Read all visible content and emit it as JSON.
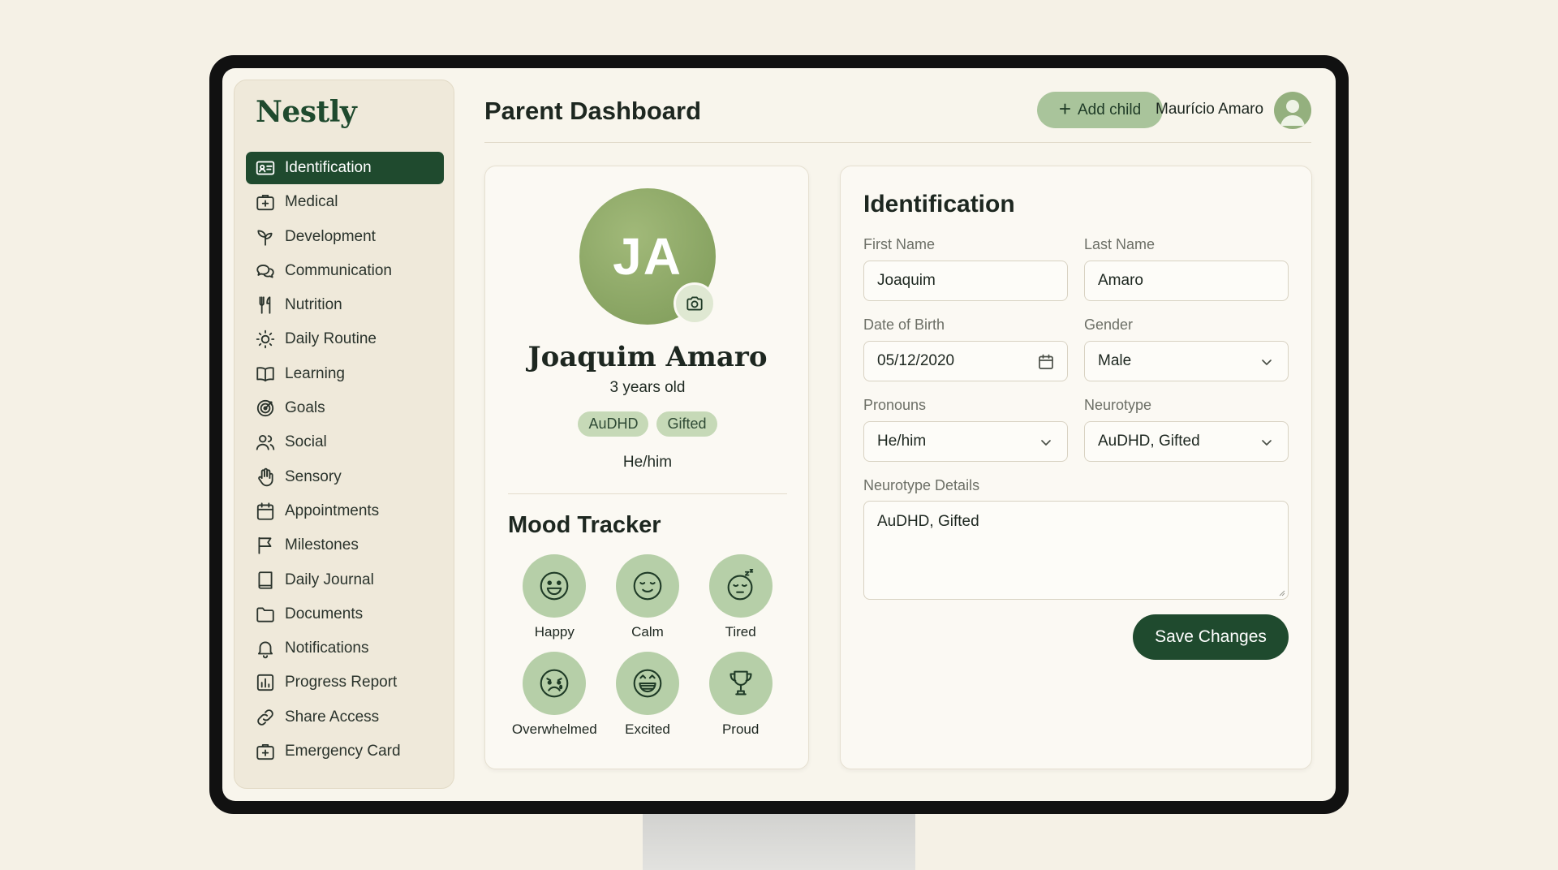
{
  "app": {
    "logo": "Nestly"
  },
  "sidebar": {
    "items": [
      {
        "label": "Identification",
        "icon": "id-card-icon",
        "active": true
      },
      {
        "label": "Medical",
        "icon": "medical-kit-icon"
      },
      {
        "label": "Development",
        "icon": "sprout-icon"
      },
      {
        "label": "Communication",
        "icon": "chat-bubbles-icon"
      },
      {
        "label": "Nutrition",
        "icon": "utensils-icon"
      },
      {
        "label": "Daily Routine",
        "icon": "sun-icon"
      },
      {
        "label": "Learning",
        "icon": "book-open-icon"
      },
      {
        "label": "Goals",
        "icon": "target-icon"
      },
      {
        "label": "Social",
        "icon": "users-icon"
      },
      {
        "label": "Sensory",
        "icon": "hand-icon"
      },
      {
        "label": "Appointments",
        "icon": "calendar-icon"
      },
      {
        "label": "Milestones",
        "icon": "flag-icon"
      },
      {
        "label": "Daily Journal",
        "icon": "journal-icon"
      },
      {
        "label": "Documents",
        "icon": "folder-icon"
      },
      {
        "label": "Notifications",
        "icon": "bell-icon"
      },
      {
        "label": "Progress Report",
        "icon": "bar-chart-icon"
      },
      {
        "label": "Share Access",
        "icon": "link-icon"
      },
      {
        "label": "Emergency Card",
        "icon": "emergency-kit-icon"
      }
    ]
  },
  "header": {
    "title": "Parent Dashboard",
    "add_child_label": "Add child",
    "user_name": "Maurício Amaro"
  },
  "profile": {
    "initials": "JA",
    "name": "Joaquim Amaro",
    "age": "3 years old",
    "tags": [
      "AuDHD",
      "Gifted"
    ],
    "pronouns": "He/him"
  },
  "mood_tracker": {
    "title": "Mood Tracker",
    "moods": [
      {
        "label": "Happy",
        "icon": "happy-face-icon"
      },
      {
        "label": "Calm",
        "icon": "calm-face-icon"
      },
      {
        "label": "Tired",
        "icon": "tired-face-icon"
      },
      {
        "label": "Overwhelmed",
        "icon": "overwhelmed-face-icon"
      },
      {
        "label": "Excited",
        "icon": "excited-face-icon"
      },
      {
        "label": "Proud",
        "icon": "trophy-icon"
      }
    ]
  },
  "form": {
    "title": "Identification",
    "first_name": {
      "label": "First Name",
      "value": "Joaquim"
    },
    "last_name": {
      "label": "Last Name",
      "value": "Amaro"
    },
    "dob": {
      "label": "Date of Birth",
      "value": "05/12/2020"
    },
    "gender": {
      "label": "Gender",
      "value": "Male"
    },
    "pronouns": {
      "label": "Pronouns",
      "value": "He/him"
    },
    "neurotype": {
      "label": "Neurotype",
      "value": "AuDHD, Gifted"
    },
    "neurotype_details": {
      "label": "Neurotype Details",
      "value": "AuDHD, Gifted"
    },
    "save_label": "Save Changes"
  },
  "colors": {
    "primary": "#1f4a2e",
    "accent": "#a9c49b",
    "background": "#f8f5ec",
    "avatar": "#8aa765"
  }
}
